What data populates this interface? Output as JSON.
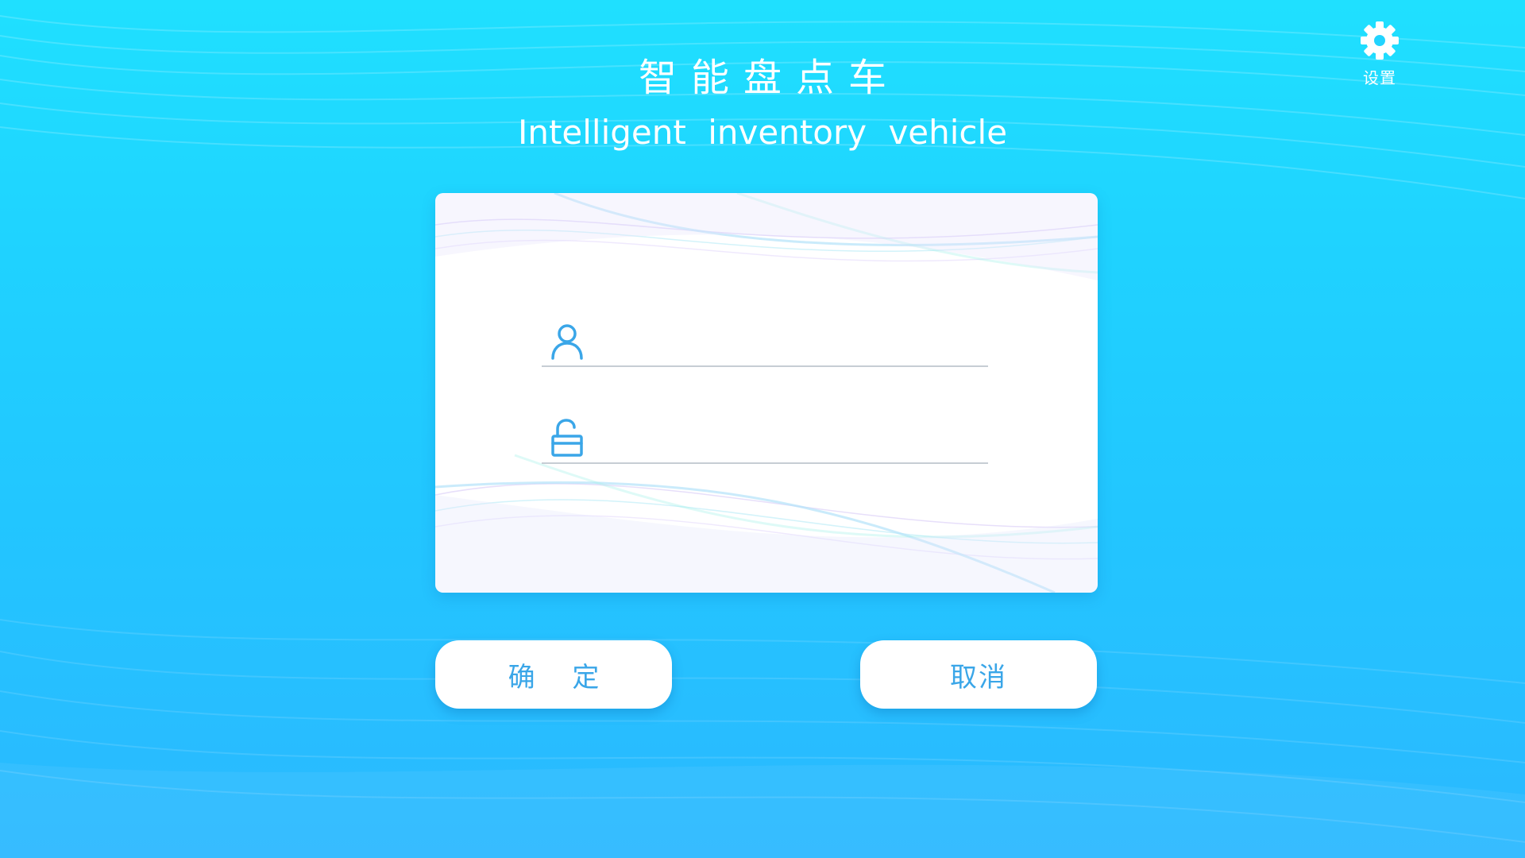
{
  "app": {
    "title_cn": "智能盘点车",
    "title_en": "Intelligent  inventory  vehicle"
  },
  "settings": {
    "label": "设置",
    "icon": "gear-icon"
  },
  "login": {
    "username": {
      "icon": "user-icon",
      "value": "",
      "placeholder": ""
    },
    "password": {
      "icon": "unlock-icon",
      "value": "",
      "placeholder": ""
    }
  },
  "actions": {
    "confirm_label": "确 定",
    "cancel_label": "取消"
  },
  "colors": {
    "background_top": "#1fe0ff",
    "background_bottom": "#2bb8ff",
    "accent": "#3aa6e8",
    "card": "#ffffff",
    "divider": "#c6cdd4"
  }
}
